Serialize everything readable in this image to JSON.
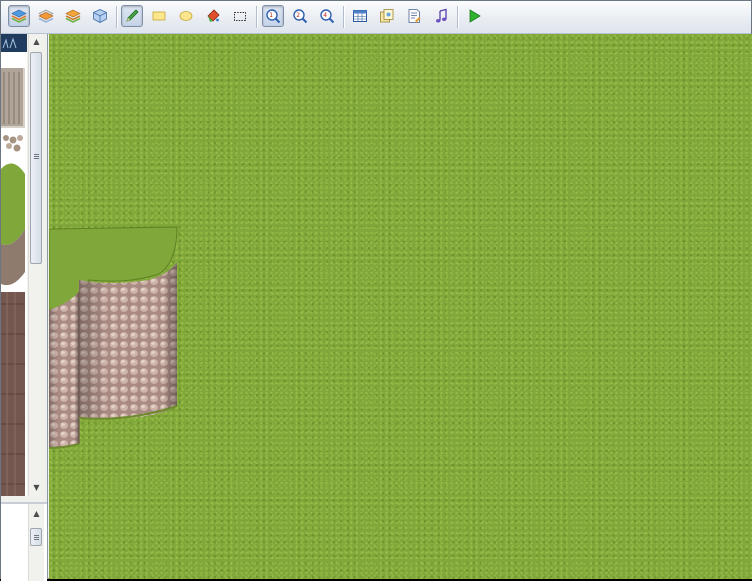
{
  "toolbar": {
    "groups": [
      {
        "name": "layers",
        "buttons": [
          "layer-1",
          "layer-2",
          "layer-3",
          "events-layer"
        ]
      },
      {
        "name": "draw",
        "buttons": [
          "pencil",
          "rectangle",
          "ellipse",
          "fill",
          "select"
        ]
      },
      {
        "name": "zoom",
        "buttons": [
          "zoom-1x",
          "zoom-2x",
          "zoom-4x"
        ]
      },
      {
        "name": "tools",
        "buttons": [
          "database",
          "materialbase",
          "script-editor",
          "sound-test"
        ]
      },
      {
        "name": "run",
        "buttons": [
          "playtest"
        ]
      }
    ],
    "active_layer": "layer-1",
    "active_tool": "pencil",
    "active_zoom": "zoom-1x"
  },
  "colors": {
    "grass": "#7fa739",
    "cliff_rock": "#b59b90",
    "playtest_green": "#2db32d",
    "toolbar_top": "#fbfcfd",
    "toolbar_bottom": "#dfe5ee"
  },
  "map": {
    "base_tile": "grass",
    "features": [
      "grass-plateau",
      "rock-cliff-face"
    ]
  }
}
